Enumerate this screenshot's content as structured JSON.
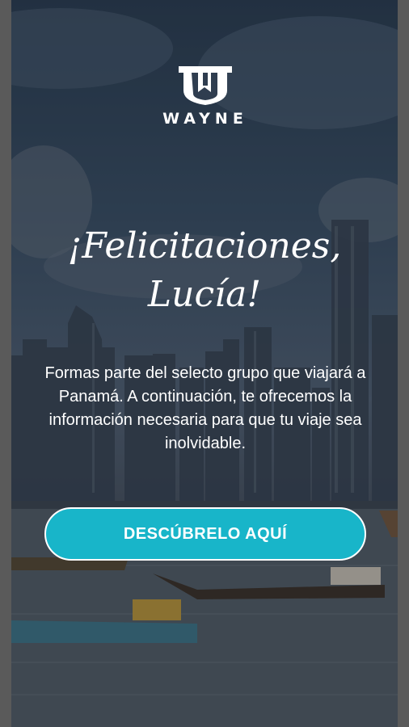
{
  "brand": {
    "name": "WAYNE",
    "logo_icon": "wayne-w-logo-icon"
  },
  "hero": {
    "title_line1": "¡Felicitaciones,",
    "title_line2": "Lucía!",
    "message": "Formas parte del selecto grupo que viajará a Panamá. A continuación, te ofrecemos la información necesaria para que tu viaje sea inolvidable."
  },
  "cta": {
    "label": "DESCÚBRELO AQUÍ"
  },
  "colors": {
    "accent": "#18b5c9",
    "text": "#ffffff",
    "frame": "#5a5a5a"
  },
  "background": {
    "description_icon": "panama-city-skyline-harbor-image"
  }
}
